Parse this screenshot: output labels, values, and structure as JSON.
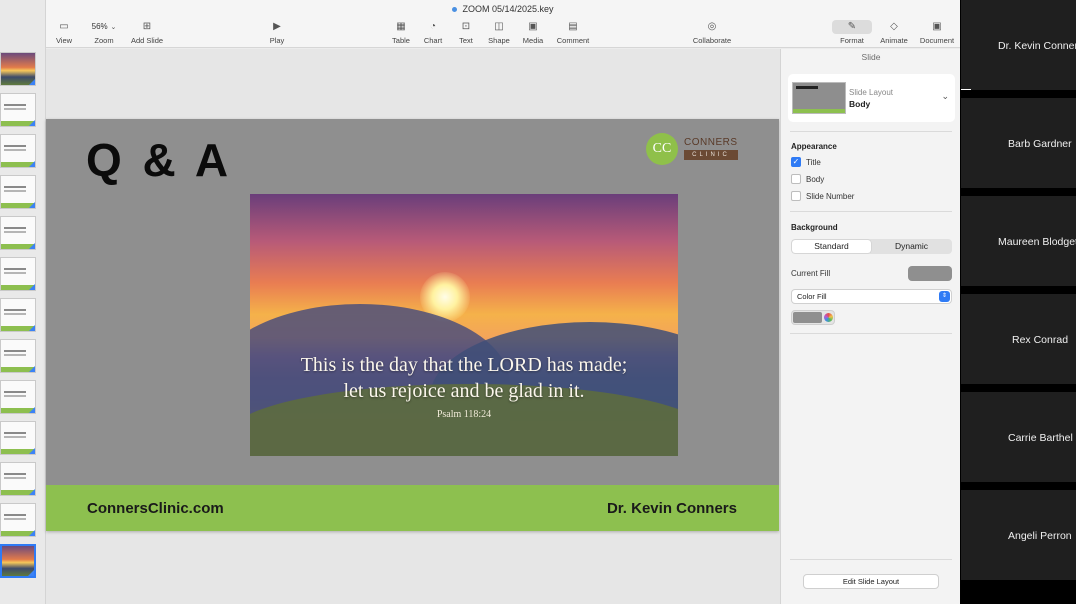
{
  "window": {
    "title": "ZOOM 05/14/2025.key"
  },
  "toolbar": {
    "view": "View",
    "zoom_value": "56%",
    "zoom": "Zoom",
    "add_slide": "Add Slide",
    "play": "Play",
    "table": "Table",
    "chart": "Chart",
    "text": "Text",
    "shape": "Shape",
    "media": "Media",
    "comment": "Comment",
    "collaborate": "Collaborate",
    "format": "Format",
    "animate": "Animate",
    "document": "Document"
  },
  "slide": {
    "heading": "Q & A",
    "logo_name": "CONNERS",
    "logo_sub": "CLINIC",
    "logo_initials": "CC",
    "verse_line1": "This is the day that the LORD has made;",
    "verse_line2": "let us rejoice and be glad in it.",
    "verse_ref": "Psalm 118:24",
    "footer_site": "ConnersClinic.com",
    "footer_author": "Dr. Kevin Conners"
  },
  "inspector": {
    "tab": "Slide",
    "layout_label": "Slide Layout",
    "layout_value": "Body",
    "appearance": "Appearance",
    "title_cb": "Title",
    "body_cb": "Body",
    "slide_number_cb": "Slide Number",
    "title_checked": true,
    "body_checked": false,
    "slide_number_checked": false,
    "background": "Background",
    "standard": "Standard",
    "dynamic": "Dynamic",
    "current_fill": "Current Fill",
    "fill_type": "Color Fill",
    "fill_color": "#8f8f8f",
    "edit_layout": "Edit Slide Layout"
  },
  "participants": [
    {
      "name": "Dr. Kevin Conners"
    },
    {
      "name": "Barb Gardner"
    },
    {
      "name": "Maureen Blodgett"
    },
    {
      "name": "Rex Conrad"
    },
    {
      "name": "Carrie Barthel"
    },
    {
      "name": "Angeli Perron"
    }
  ],
  "colors": {
    "accent": "#2f7bf5",
    "brand_green": "#8dc04f",
    "slide_bg": "#8f8f8f"
  }
}
